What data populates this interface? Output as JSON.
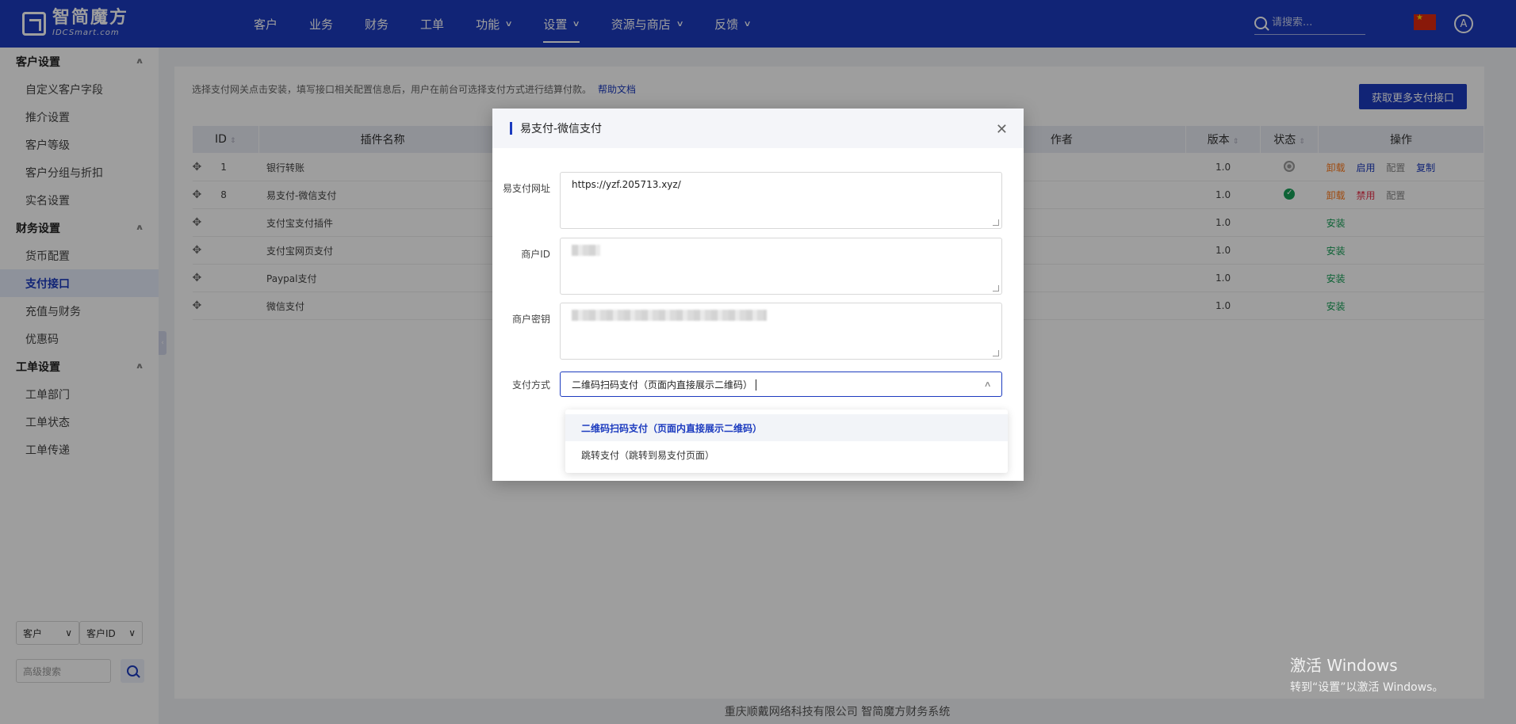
{
  "app": {
    "logo_cn": "智简魔方",
    "logo_en": "IDCSmart.com"
  },
  "nav": {
    "items": [
      {
        "label": "客户"
      },
      {
        "label": "业务"
      },
      {
        "label": "财务"
      },
      {
        "label": "工单"
      },
      {
        "label": "功能"
      },
      {
        "label": "设置"
      },
      {
        "label": "资源与商店"
      },
      {
        "label": "反馈"
      }
    ],
    "search_placeholder": "请搜索...",
    "avatar_letter": "A"
  },
  "sidebar": {
    "groups": [
      {
        "label": "客户设置",
        "items": [
          "自定义客户字段",
          "推介设置",
          "客户等级",
          "客户分组与折扣",
          "实名设置"
        ]
      },
      {
        "label": "财务设置",
        "items": [
          "货币配置",
          "支付接口",
          "充值与财务",
          "优惠码"
        ]
      },
      {
        "label": "工单设置",
        "items": [
          "工单部门",
          "工单状态",
          "工单传递"
        ]
      }
    ],
    "active_item": "支付接口",
    "filter_select_1": "客户",
    "filter_select_2": "客户ID",
    "adv_search_placeholder": "高级搜索"
  },
  "main": {
    "hint": "选择支付网关点击安装，填写接口相关配置信息后，用户在前台可选择支付方式进行结算付款。",
    "help_link": "帮助文档",
    "get_more_button": "获取更多支付接口",
    "table": {
      "headers": {
        "id": "ID",
        "name": "插件名称",
        "author": "作者",
        "version": "版本",
        "status": "状态",
        "actions": "操作"
      },
      "rows": [
        {
          "id": "1",
          "name": "银行转账",
          "version": "1.0",
          "status": "off",
          "actions": [
            "卸载",
            "启用",
            "配置",
            "复制"
          ]
        },
        {
          "id": "8",
          "name": "易支付-微信支付",
          "version": "1.0",
          "status": "on",
          "actions": [
            "卸载",
            "禁用",
            "配置"
          ]
        },
        {
          "id": "",
          "name": "支付宝支付插件",
          "version": "1.0",
          "status": "",
          "actions": [
            "安装"
          ]
        },
        {
          "id": "",
          "name": "支付宝网页支付",
          "version": "1.0",
          "status": "",
          "actions": [
            "安装"
          ]
        },
        {
          "id": "",
          "name": "Paypal支付",
          "version": "1.0",
          "status": "",
          "actions": [
            "安装"
          ]
        },
        {
          "id": "",
          "name": "微信支付",
          "version": "1.0",
          "status": "",
          "actions": [
            "安装"
          ]
        }
      ]
    }
  },
  "footer": "重庆顺戴网络科技有限公司 智简魔方财务系统",
  "watermark": {
    "title": "激活 Windows",
    "sub": "转到“设置”以激活 Windows。"
  },
  "dialog": {
    "title": "易支付-微信支付",
    "fields": {
      "url_label": "易支付网址",
      "url_value": "https://yzf.205713.xyz/",
      "merchant_id_label": "商户ID",
      "merchant_key_label": "商户密钥",
      "pay_method_label": "支付方式",
      "pay_method_value": "二维码扫码支付（页面内直接展示二维码）"
    },
    "options": [
      "二维码扫码支付（页面内直接展示二维码）",
      "跳转支付（跳转到易支付页面）"
    ]
  },
  "colors": {
    "primary": "#1c3bbf",
    "uninstall": "#ff7a1a",
    "disable": "#e8324b",
    "install": "#18a058"
  }
}
